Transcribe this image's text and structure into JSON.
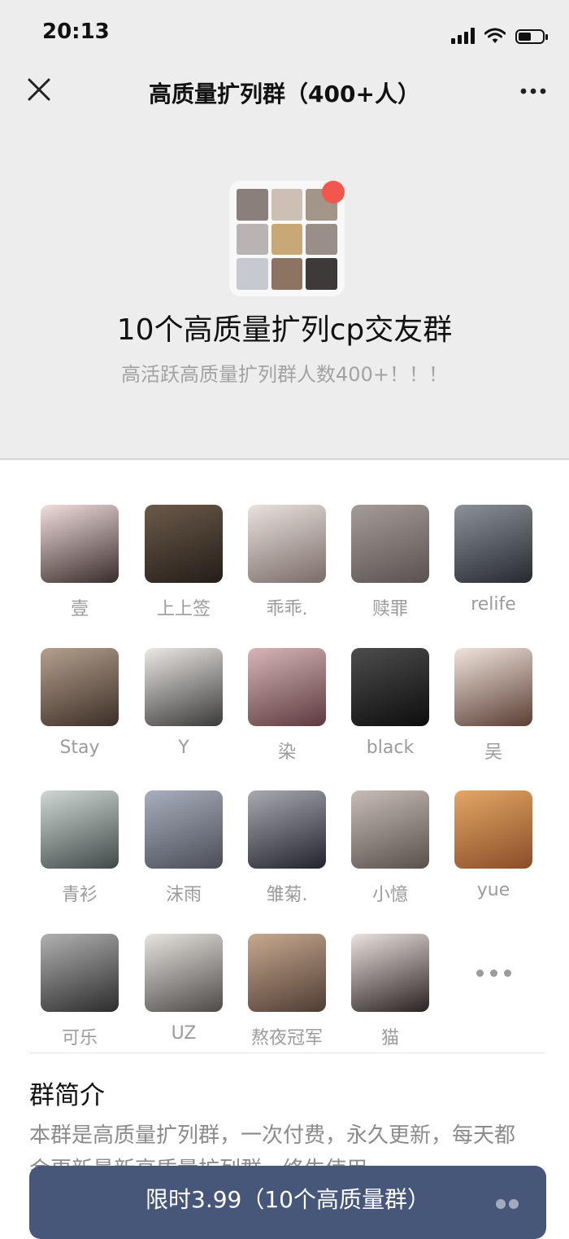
{
  "status_bar": {
    "time": "20:13",
    "battery_level": 0.55
  },
  "nav": {
    "title": "高质量扩列群（400+人）",
    "close_icon": "close-icon",
    "more_icon": "more-icon"
  },
  "group": {
    "name": "10个高质量扩列cp交友群",
    "tagline": "高活跃高质量扩列群人数400+！！！",
    "avatar_tiles": [
      "#8a7f7a",
      "#cdbfb4",
      "#a39587",
      "#b9b3b3",
      "#c9a877",
      "#9a8f88",
      "#c7c9d1",
      "#8d7462",
      "#3e3a3a"
    ],
    "badge_color": "#f2574d"
  },
  "members": [
    {
      "name": "壹",
      "colors": [
        "#f1dede",
        "#3a2c2c"
      ]
    },
    {
      "name": "上上签",
      "colors": [
        "#6b5a4a",
        "#241d18"
      ]
    },
    {
      "name": "乖乖.",
      "colors": [
        "#e9e2de",
        "#7a6b68"
      ]
    },
    {
      "name": "赎罪",
      "colors": [
        "#a49c98",
        "#5a5250"
      ]
    },
    {
      "name": "relife",
      "colors": [
        "#8c9298",
        "#262a30"
      ]
    },
    {
      "name": "Stay",
      "colors": [
        "#b3a08e",
        "#3d2f27"
      ]
    },
    {
      "name": "Y",
      "colors": [
        "#ece8e4",
        "#3a3a3a"
      ]
    },
    {
      "name": "染",
      "colors": [
        "#d6b6b7",
        "#5c3a3f"
      ]
    },
    {
      "name": "black",
      "colors": [
        "#4d4d4d",
        "#0d0d0d"
      ]
    },
    {
      "name": "吴",
      "colors": [
        "#f0e4dc",
        "#5a3e34"
      ]
    },
    {
      "name": "青衫",
      "colors": [
        "#cfd8d4",
        "#3f4a48"
      ]
    },
    {
      "name": "沫雨",
      "colors": [
        "#a8aebc",
        "#4b4e58"
      ]
    },
    {
      "name": "雏菊.",
      "colors": [
        "#a9a9b1",
        "#23232b"
      ]
    },
    {
      "name": "小憶",
      "colors": [
        "#c8bdb6",
        "#58504b"
      ]
    },
    {
      "name": "yue",
      "colors": [
        "#e2a765",
        "#8a4d28"
      ]
    },
    {
      "name": "可乐",
      "colors": [
        "#b1b1b1",
        "#2c2c2c"
      ]
    },
    {
      "name": "UZ",
      "colors": [
        "#e7e4e0",
        "#4d4a47"
      ]
    },
    {
      "name": "熬夜冠军",
      "colors": [
        "#c7a990",
        "#4f3d33"
      ]
    },
    {
      "name": "猫",
      "colors": [
        "#e9e2de",
        "#2a2222"
      ]
    }
  ],
  "intro": {
    "title": "群简介",
    "text": "本群是高质量扩列群，一次付费，永久更新，每天都会更新最新高质量扩列群，终生使用"
  },
  "buy_button": {
    "label": "限时3.99（10个高质量群）",
    "color": "#46577a"
  }
}
